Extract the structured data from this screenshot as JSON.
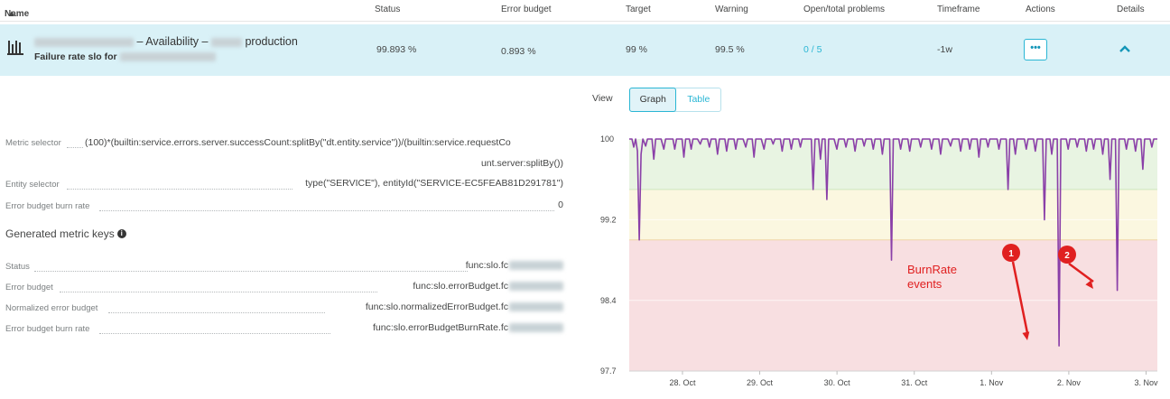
{
  "table": {
    "headers": {
      "name": "Name",
      "status": "Status",
      "error_budget": "Error budget",
      "target": "Target",
      "warning": "Warning",
      "problems": "Open/total problems",
      "timeframe": "Timeframe",
      "actions": "Actions",
      "details": "Details"
    },
    "row": {
      "title_mid": "– Availability –",
      "title_end": "production",
      "subtitle": "Failure rate slo for",
      "status": "99.893 %",
      "error_budget": "0.893 %",
      "target": "99 %",
      "warning": "99.5 %",
      "problems": "0 / 5",
      "timeframe": "-1w",
      "actions_label": "•••"
    }
  },
  "details": {
    "metric_selector_label": "Metric selector",
    "metric_selector_line1": "(100)*(builtin:service.errors.server.successCount:splitBy(\"dt.entity.service\"))/(builtin:service.requestCo",
    "metric_selector_line2": "unt.server:splitBy())",
    "entity_selector_label": "Entity selector",
    "entity_selector_value": "type(\"SERVICE\"), entityId(\"SERVICE-EC5FEAB81D291781\")",
    "burn_rate_label": "Error budget burn rate",
    "burn_rate_value": "0",
    "generated_title": "Generated metric keys",
    "info_glyph": "i",
    "keys": [
      {
        "label": "Status",
        "value": "func:slo.fc"
      },
      {
        "label": "Error budget",
        "value": "func:slo.errorBudget.fc"
      },
      {
        "label": "Normalized error budget",
        "value": "func:slo.normalizedErrorBudget.fc"
      },
      {
        "label": "Error budget burn rate",
        "value": "func:slo.errorBudgetBurnRate.fc"
      }
    ]
  },
  "view": {
    "label": "View",
    "graph": "Graph",
    "table": "Table",
    "selected": "Graph"
  },
  "colors": {
    "accent": "#2ab6d4",
    "selected_row": "#d9f1f7",
    "zone_good": "#e8f4e2",
    "zone_warning": "#fbf7e0",
    "zone_bad": "#f8dfe1",
    "series": "#8a3fa8",
    "annotation": "#e02020"
  },
  "chart_data": {
    "type": "line",
    "ylim": [
      97.7,
      100
    ],
    "yticks": [
      "100",
      "99.2",
      "98.4",
      "97.7"
    ],
    "xticks": [
      "28. Oct",
      "29. Oct",
      "30. Oct",
      "31. Oct",
      "1. Nov",
      "2. Nov",
      "3. Nov"
    ],
    "zones": [
      {
        "from": 99.5,
        "to": 100,
        "color": "#e8f4e2"
      },
      {
        "from": 99.0,
        "to": 99.5,
        "color": "#fbf7e0"
      },
      {
        "from": 97.7,
        "to": 99.0,
        "color": "#f8dfe1"
      }
    ],
    "x_start": 27.6,
    "x_end": 3.85,
    "series": [
      {
        "color": "#8a3fa8",
        "points": [
          [
            0.0,
            100
          ],
          [
            0.03,
            100
          ],
          [
            0.05,
            99.92
          ],
          [
            0.07,
            100
          ],
          [
            0.09,
            99.88
          ],
          [
            0.11,
            99.0
          ],
          [
            0.13,
            99.85
          ],
          [
            0.15,
            100
          ],
          [
            0.18,
            99.93
          ],
          [
            0.2,
            100
          ],
          [
            0.25,
            100
          ],
          [
            0.27,
            99.8
          ],
          [
            0.29,
            100
          ],
          [
            0.35,
            100
          ],
          [
            0.38,
            99.9
          ],
          [
            0.4,
            100
          ],
          [
            0.48,
            100
          ],
          [
            0.5,
            99.9
          ],
          [
            0.52,
            100
          ],
          [
            0.58,
            100
          ],
          [
            0.6,
            99.82
          ],
          [
            0.62,
            100
          ],
          [
            0.66,
            100
          ],
          [
            0.68,
            99.9
          ],
          [
            0.7,
            100
          ],
          [
            0.75,
            100
          ],
          [
            0.78,
            99.95
          ],
          [
            0.8,
            100
          ],
          [
            0.86,
            100
          ],
          [
            0.88,
            99.92
          ],
          [
            0.9,
            100
          ],
          [
            0.95,
            100
          ],
          [
            0.97,
            99.85
          ],
          [
            0.99,
            100
          ],
          [
            1.05,
            100
          ],
          [
            1.07,
            99.88
          ],
          [
            1.09,
            100
          ],
          [
            1.15,
            100
          ],
          [
            1.17,
            99.9
          ],
          [
            1.19,
            100
          ],
          [
            1.25,
            100
          ],
          [
            1.28,
            99.92
          ],
          [
            1.3,
            100
          ],
          [
            1.35,
            100
          ],
          [
            1.37,
            99.82
          ],
          [
            1.39,
            100
          ],
          [
            1.45,
            100
          ],
          [
            1.48,
            99.9
          ],
          [
            1.5,
            100
          ],
          [
            1.56,
            100
          ],
          [
            1.58,
            99.95
          ],
          [
            1.6,
            100
          ],
          [
            1.66,
            100
          ],
          [
            1.68,
            99.88
          ],
          [
            1.7,
            100
          ],
          [
            1.76,
            100
          ],
          [
            1.78,
            99.9
          ],
          [
            1.8,
            100
          ],
          [
            1.86,
            100
          ],
          [
            1.88,
            99.92
          ],
          [
            1.9,
            100
          ],
          [
            2.0,
            100
          ],
          [
            2.02,
            99.5
          ],
          [
            2.04,
            100
          ],
          [
            2.08,
            100
          ],
          [
            2.1,
            99.8
          ],
          [
            2.12,
            100
          ],
          [
            2.15,
            100
          ],
          [
            2.17,
            99.4
          ],
          [
            2.19,
            100
          ],
          [
            2.25,
            100
          ],
          [
            2.28,
            99.9
          ],
          [
            2.3,
            100
          ],
          [
            2.36,
            100
          ],
          [
            2.38,
            99.92
          ],
          [
            2.4,
            100
          ],
          [
            2.46,
            100
          ],
          [
            2.48,
            99.88
          ],
          [
            2.5,
            100
          ],
          [
            2.56,
            100
          ],
          [
            2.58,
            99.93
          ],
          [
            2.6,
            100
          ],
          [
            2.66,
            100
          ],
          [
            2.68,
            99.9
          ],
          [
            2.7,
            100
          ],
          [
            2.76,
            100
          ],
          [
            2.78,
            99.85
          ],
          [
            2.8,
            100
          ],
          [
            2.86,
            100
          ],
          [
            2.88,
            98.8
          ],
          [
            2.9,
            100
          ],
          [
            2.96,
            100
          ],
          [
            2.98,
            99.9
          ],
          [
            3.0,
            100
          ],
          [
            3.06,
            100
          ],
          [
            3.08,
            99.88
          ],
          [
            3.1,
            100
          ],
          [
            3.18,
            100
          ],
          [
            3.2,
            99.92
          ],
          [
            3.22,
            100
          ],
          [
            3.3,
            100
          ],
          [
            3.32,
            99.9
          ],
          [
            3.34,
            100
          ],
          [
            3.4,
            100
          ],
          [
            3.42,
            99.85
          ],
          [
            3.44,
            100
          ],
          [
            3.5,
            100
          ],
          [
            3.53,
            99.93
          ],
          [
            3.55,
            100
          ],
          [
            3.62,
            100
          ],
          [
            3.64,
            99.88
          ],
          [
            3.66,
            100
          ],
          [
            3.72,
            100
          ],
          [
            3.74,
            99.9
          ],
          [
            3.76,
            100
          ],
          [
            3.82,
            100
          ],
          [
            3.84,
            99.82
          ],
          [
            3.86,
            100
          ],
          [
            3.92,
            100
          ],
          [
            3.94,
            99.92
          ],
          [
            3.96,
            100
          ],
          [
            4.04,
            100
          ],
          [
            4.06,
            99.9
          ],
          [
            4.08,
            100
          ],
          [
            4.14,
            100
          ],
          [
            4.16,
            99.5
          ],
          [
            4.18,
            100
          ],
          [
            4.22,
            100
          ],
          [
            4.24,
            99.85
          ],
          [
            4.26,
            100
          ],
          [
            4.34,
            100
          ],
          [
            4.36,
            99.9
          ],
          [
            4.38,
            100
          ],
          [
            4.44,
            100
          ],
          [
            4.46,
            99.88
          ],
          [
            4.48,
            100
          ],
          [
            4.54,
            100
          ],
          [
            4.56,
            99.2
          ],
          [
            4.58,
            100
          ],
          [
            4.62,
            100
          ],
          [
            4.64,
            99.85
          ],
          [
            4.66,
            100
          ],
          [
            4.7,
            100
          ],
          [
            4.72,
            97.95
          ],
          [
            4.74,
            100
          ],
          [
            4.8,
            100
          ],
          [
            4.82,
            99.9
          ],
          [
            4.84,
            100
          ],
          [
            4.9,
            100
          ],
          [
            4.92,
            99.92
          ],
          [
            4.94,
            100
          ],
          [
            5.0,
            100
          ],
          [
            5.02,
            99.88
          ],
          [
            5.04,
            100
          ],
          [
            5.08,
            100
          ],
          [
            5.1,
            99.9
          ],
          [
            5.12,
            100
          ],
          [
            5.18,
            100
          ],
          [
            5.2,
            99.85
          ],
          [
            5.22,
            100
          ],
          [
            5.26,
            100
          ],
          [
            5.28,
            99.6
          ],
          [
            5.3,
            100
          ],
          [
            5.34,
            100
          ],
          [
            5.36,
            98.5
          ],
          [
            5.38,
            100
          ],
          [
            5.44,
            100
          ],
          [
            5.46,
            99.9
          ],
          [
            5.48,
            100
          ],
          [
            5.54,
            100
          ],
          [
            5.56,
            99.88
          ],
          [
            5.58,
            100
          ],
          [
            5.62,
            100
          ],
          [
            5.64,
            99.7
          ],
          [
            5.66,
            100
          ],
          [
            5.72,
            100
          ],
          [
            5.74,
            99.92
          ],
          [
            5.76,
            100
          ],
          [
            5.8,
            100
          ]
        ]
      }
    ],
    "annotations": {
      "text_line1": "BurnRate",
      "text_line2": "events",
      "markers": [
        "1",
        "2"
      ]
    }
  }
}
